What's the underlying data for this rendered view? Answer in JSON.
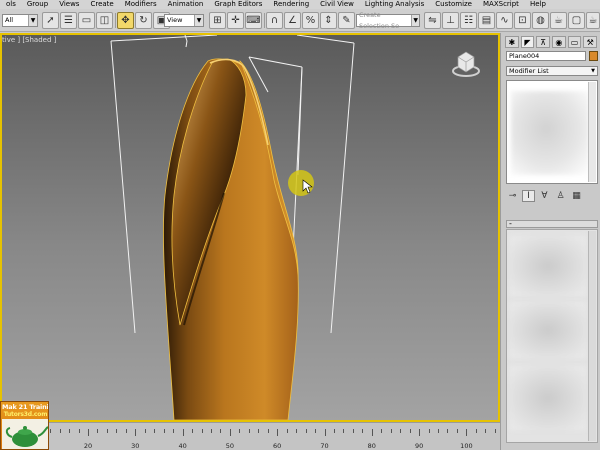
{
  "menu": {
    "items": [
      "ols",
      "Group",
      "Views",
      "Create",
      "Modifiers",
      "Animation",
      "Graph Editors",
      "Rendering",
      "Civil View",
      "Lighting Analysis",
      "Customize",
      "MAXScript",
      "Help"
    ]
  },
  "toolbar": {
    "selection_filter": "All",
    "reference_coord": "View",
    "named_selection_placeholder": "Create Selection Se",
    "active_tool": "select-and-move"
  },
  "viewport": {
    "label": "tive ] [Shaded ]",
    "border_color": "#e6c200",
    "object_color": "#d98a2b"
  },
  "command_panel": {
    "tabs": [
      "create-icon",
      "modify-icon",
      "hierarchy-icon",
      "motion-icon",
      "display-icon",
      "utilities-icon"
    ],
    "active_tab": "modify-icon",
    "object_name": "Plane004",
    "modifier_list": "Modifier List",
    "rollout_header": "-"
  },
  "timeline": {
    "labels": [
      "20",
      "30",
      "40",
      "50",
      "60",
      "70",
      "80",
      "90",
      "100"
    ]
  },
  "watermark": {
    "line1": "Mak 21 Training",
    "line2": "Tutors3d.com"
  }
}
